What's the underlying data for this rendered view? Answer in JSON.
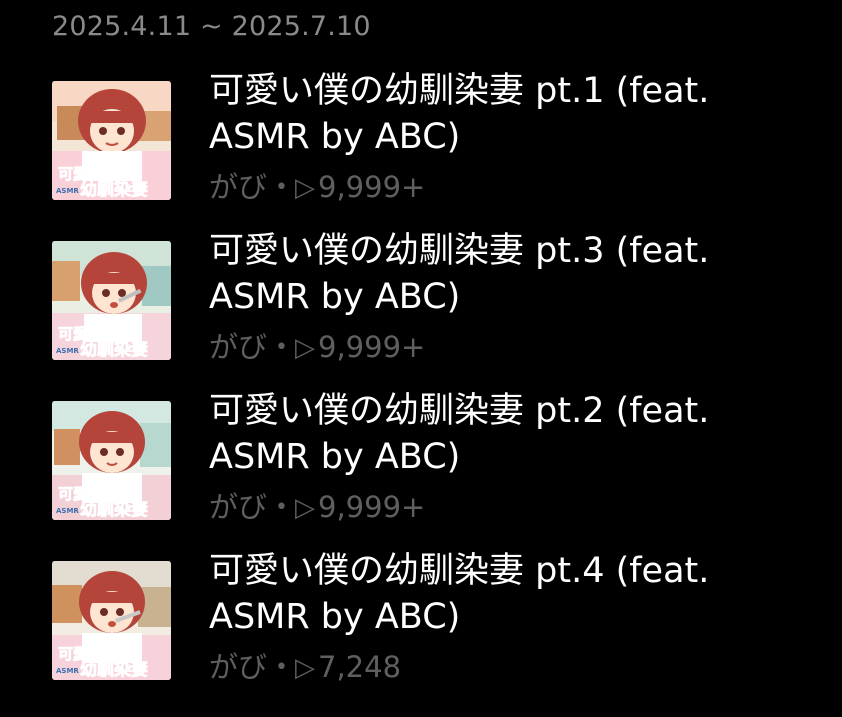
{
  "header": {
    "date_range": "2025.4.11 ~ 2025.7.10"
  },
  "tracks": [
    {
      "title": "可愛い僕の幼馴染妻 pt.1 (feat. ASMR by ABC)",
      "artist": "がび",
      "plays": "9,999+",
      "icon": "play-outline-icon"
    },
    {
      "title": "可愛い僕の幼馴染妻 pt.3 (feat. ASMR by ABC)",
      "artist": "がび",
      "plays": "9,999+",
      "icon": "play-outline-icon"
    },
    {
      "title": "可愛い僕の幼馴染妻 pt.2 (feat. ASMR by ABC)",
      "artist": "がび",
      "plays": "9,999+",
      "icon": "play-outline-icon"
    },
    {
      "title": "可愛い僕の幼馴染妻 pt.4 (feat. ASMR by ABC)",
      "artist": "がび",
      "plays": "7,248",
      "icon": "play-outline-icon"
    }
  ],
  "thumbnail": {
    "logo_line1": "可愛い僕の",
    "logo_line2": "幼馴染妻",
    "logo_small": "ASMR"
  },
  "colors": {
    "background": "#000000",
    "title_text": "#ffffff",
    "meta_text": "#5f5f5f",
    "date_text": "#8a8a8a"
  }
}
